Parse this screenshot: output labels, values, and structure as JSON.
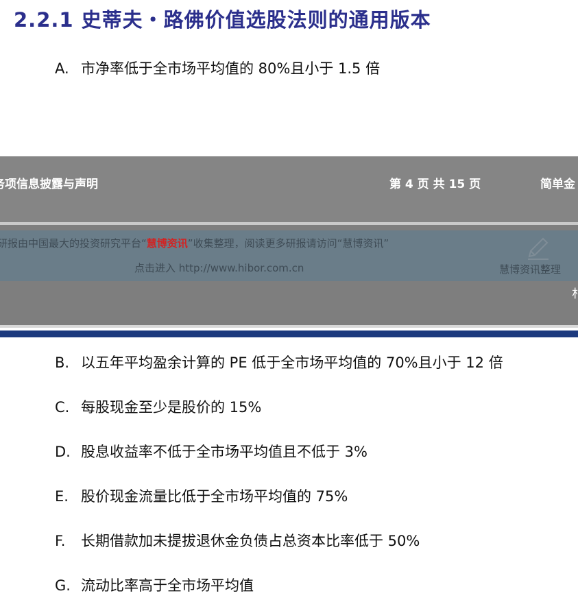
{
  "heading": "2.2.1 史蒂夫・路佛价值选股法则的通用版本",
  "rules": [
    {
      "letter": "A.",
      "text": "市净率低于全市场平均值的 80%且小于 1.5 倍"
    },
    {
      "letter": "B.",
      "text": "以五年平均盈余计算的 PE 低于全市场平均值的 70%且小于 12 倍"
    },
    {
      "letter": "C.",
      "text": "每股现金至少是股价的 15%"
    },
    {
      "letter": "D.",
      "text": "股息收益率不低于全市场平均值且不低于 3%"
    },
    {
      "letter": "E.",
      "text": "股价现金流量比低于全市场平均值的 75%"
    },
    {
      "letter": "F.",
      "text": "长期借款加未提拔退休金负债占总资本比率低于 50%"
    },
    {
      "letter": "G.",
      "text": "流动比率高于全市场平均值"
    }
  ],
  "footer": {
    "left": "务项信息披露与声明",
    "pages": "第 4 页 共 15 页",
    "right": "简单金",
    "edge_char": "朴"
  },
  "watermark": {
    "line1_prefix": "研报由中国最大的投资研究平台“",
    "brand": "慧博资讯",
    "line1_suffix": "”收集整理，阅读更多研报请访问“慧博资讯”",
    "line2": "点击进入 http://www.hibor.com.cn",
    "signature": "慧博资讯整理"
  },
  "colors": {
    "heading": "#2b2f8c",
    "band": "#7e7e7e",
    "watermark_bg": "#6a7d89",
    "brand_red": "#d02424",
    "blue_bar": "#1c3a7e"
  },
  "icons": {
    "watermark_pen": "pen-icon"
  }
}
